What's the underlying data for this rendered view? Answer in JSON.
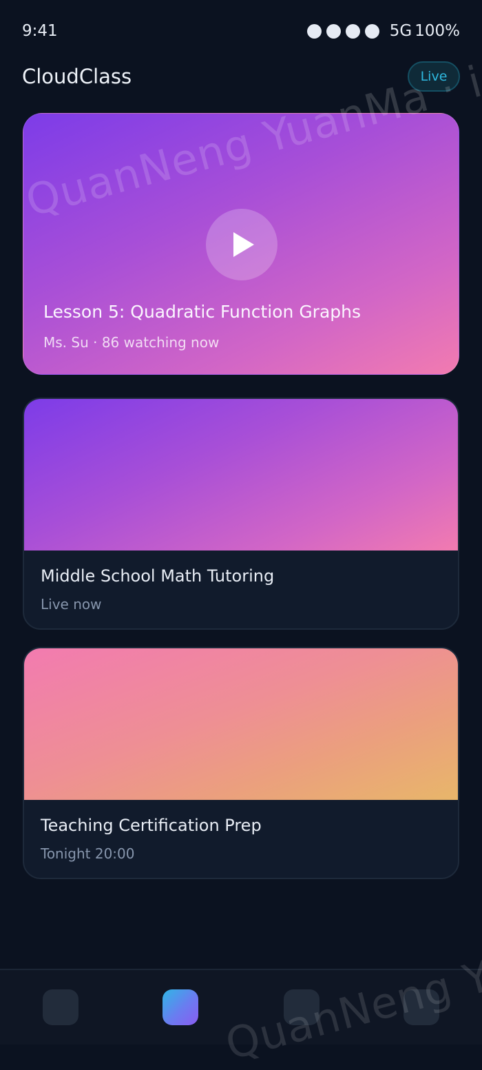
{
  "status_bar": {
    "time": "9:41",
    "network": "5G",
    "battery": "100%"
  },
  "header": {
    "title": "CloudClass",
    "live_label": "Live"
  },
  "hero": {
    "title": "Lesson 5: Quadratic Function Graphs",
    "meta": "Ms. Su · 86 watching now"
  },
  "courses": [
    {
      "title": "Middle School Math Tutoring",
      "subtitle": "Live now"
    },
    {
      "title": "Teaching Certification Prep",
      "subtitle": "Tonight 20:00"
    }
  ],
  "watermark": {
    "text_1": "QuanNeng YuanMa · in",
    "text_2": "QuanNeng YuanMa"
  },
  "colors": {
    "background": "#0b1220",
    "accent": "#2fb9e0",
    "card": "#111b2c",
    "gradient_purple_start": "#7d3ce8",
    "gradient_pink_end": "#f27bb0",
    "gradient_orange_end": "#e8b66a"
  }
}
